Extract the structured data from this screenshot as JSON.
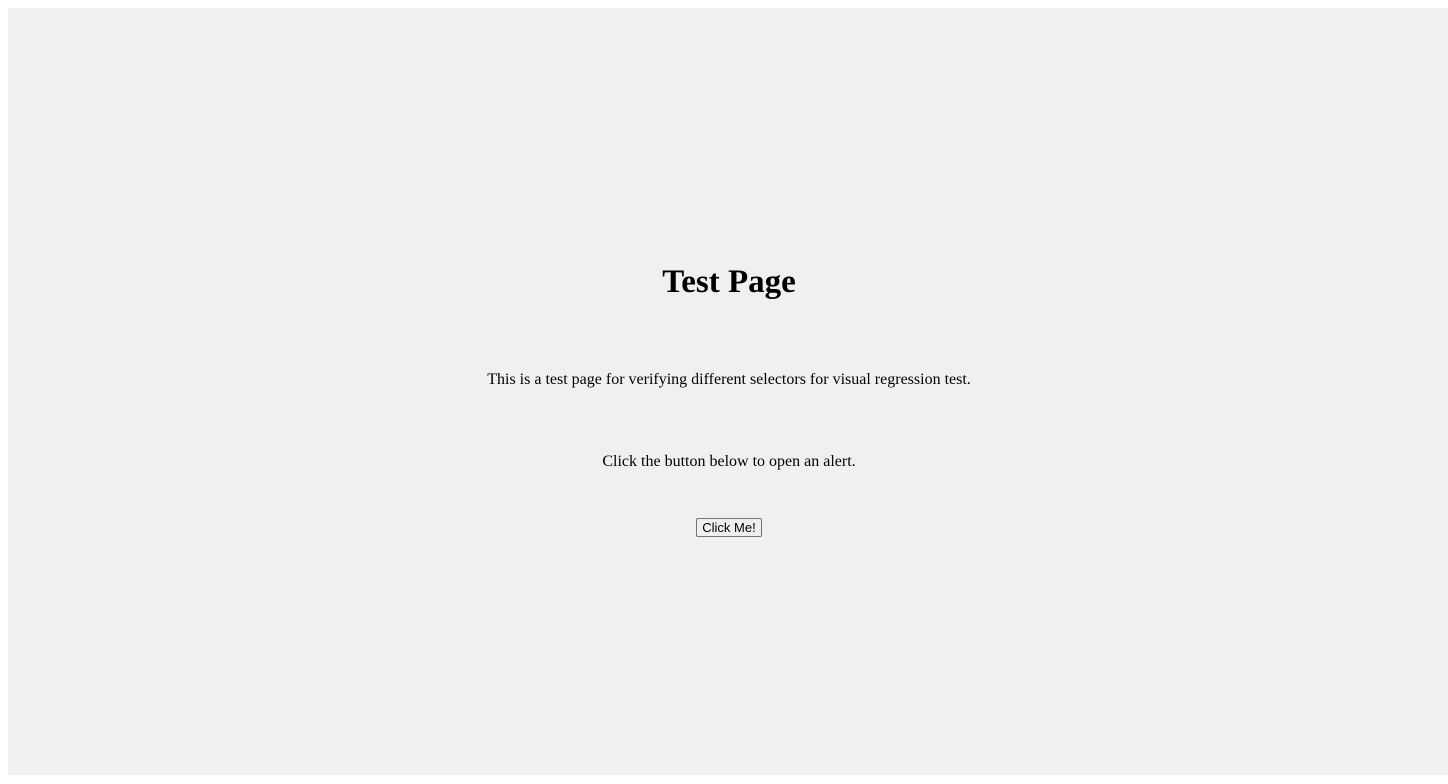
{
  "page": {
    "title": "Test Page",
    "description": "This is a test page for verifying different selectors for visual regression test.",
    "instruction": "Click the button below to open an alert.",
    "button_label": "Click Me!"
  },
  "colors": {
    "background": "#f0f0f0",
    "text": "#000000"
  }
}
